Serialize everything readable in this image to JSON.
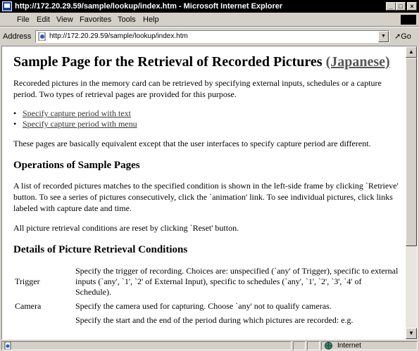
{
  "window": {
    "title": "http://172.20.29.59/sample/lookup/index.htm - Microsoft Internet Explorer",
    "minimize": "_",
    "maximize": "□",
    "close": "×"
  },
  "menu": [
    {
      "label": "File"
    },
    {
      "label": "Edit"
    },
    {
      "label": "View"
    },
    {
      "label": "Favorites"
    },
    {
      "label": "Tools"
    },
    {
      "label": "Help"
    }
  ],
  "address": {
    "label": "Address",
    "url": "http://172.20.29.59/sample/lookup/index.htm",
    "go_label": "Go"
  },
  "page": {
    "title": "Sample Page for the Retrieval of Recorded Pictures",
    "title_link": "(Japanese)",
    "intro": "Recoreded pictures in the memory card can be retrieved by specifying external inputs, schedules or a capture period. Two types of retrieval pages are provided for this purpose.",
    "links": [
      "Specify capture period with text",
      "Specify capture period with menu"
    ],
    "equivalence_note": "These pages are basically equivalent except that the user interfaces to specify capture period are different.",
    "operations_heading": "Operations of Sample Pages",
    "operations_text": "A list of recorded pictures matches to the specified condition is shown in the left-side frame by clicking `Retrieve' button. To see a series of pictures consecutively, click the `animation' link. To see individual pictures, click links labeled with capture date and time.",
    "reset_text": "All picture retrieval conditions are reset by clicking `Reset' button.",
    "details_heading": "Details of Picture Retrieval Conditions",
    "conditions": [
      {
        "name": "Trigger",
        "desc": "Specify the trigger of recording. Choices are: unspecified (`any' of Trigger), specific to external inputs (`any', `1', `2' of External Input), specific to schedules (`any', `1', `2', `3', `4' of Schedule)."
      },
      {
        "name": "Camera",
        "desc": "Specify the camera used for capturing. Choose `any' not to qualify cameras."
      },
      {
        "name": "",
        "desc": "Specify the start and the end of the period during which pictures are recorded: e.g."
      }
    ]
  },
  "status": {
    "zone": "Internet"
  }
}
